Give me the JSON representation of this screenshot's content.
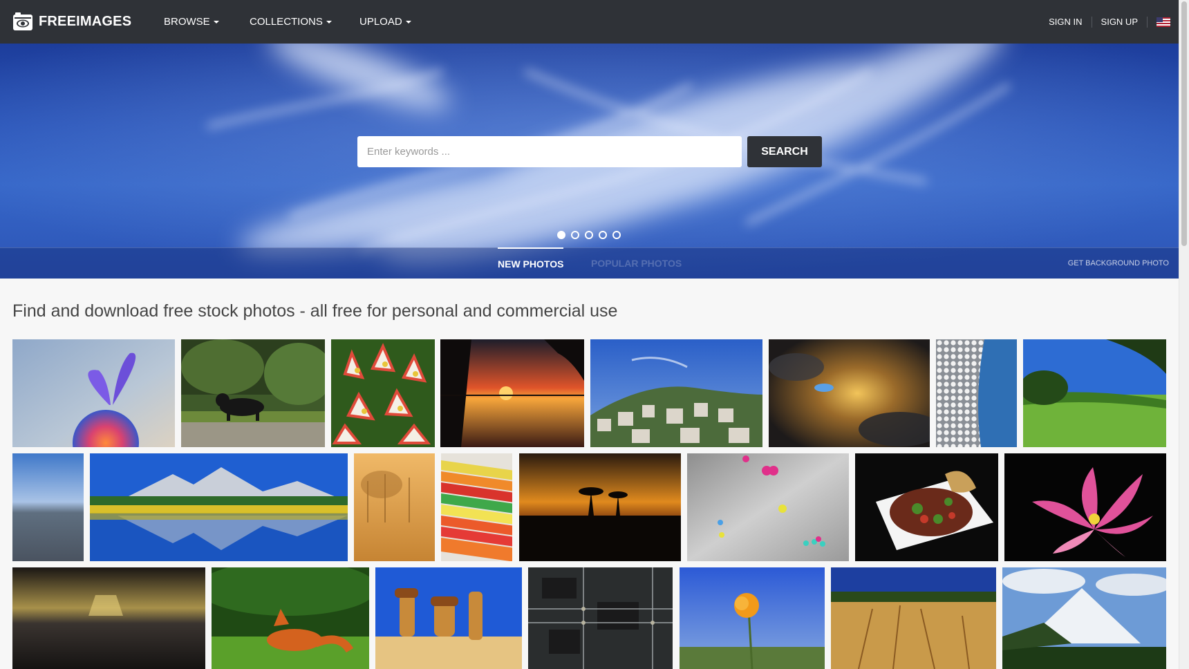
{
  "brand": {
    "name": "FREEIMAGES",
    "icon": "camera-eye-icon"
  },
  "nav": {
    "browse": "BROWSE",
    "collections": "COLLECTIONS",
    "upload": "UPLOAD",
    "sign_in": "SIGN IN",
    "sign_up": "SIGN UP",
    "language_icon": "us-flag-icon"
  },
  "hero": {
    "search_placeholder": "Enter keywords ...",
    "search_button": "SEARCH",
    "carousel_count": 5,
    "carousel_active": 1,
    "tabs": {
      "new": "NEW PHOTOS",
      "popular": "POPULAR PHOTOS"
    },
    "get_background": "GET BACKGROUND PHOTO"
  },
  "content": {
    "tagline": "Find and download free stock photos - all free for personal and commercial use"
  },
  "colors": {
    "navbar": "#2f3237",
    "sky": "#2a55b9",
    "page_bg": "#f7f7f7"
  }
}
